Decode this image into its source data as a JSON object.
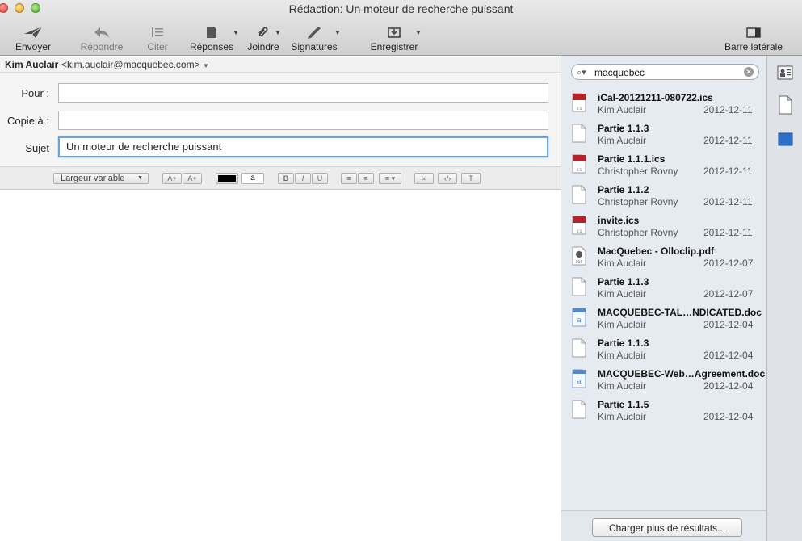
{
  "window": {
    "title": "Rédaction: Un moteur de recherche puissant"
  },
  "toolbar": {
    "send": "Envoyer",
    "reply": "Répondre",
    "quote": "Citer",
    "responses": "Réponses",
    "attach": "Joindre",
    "signatures": "Signatures",
    "save": "Enregistrer",
    "sidebar": "Barre latérale"
  },
  "from": {
    "name": "Kim Auclair",
    "address": "<kim.auclair@macquebec.com>"
  },
  "fields": {
    "to_label": "Pour :",
    "to_value": "",
    "cc_label": "Copie à :",
    "cc_value": "",
    "subject_label": "Sujet",
    "subject_value": "Un moteur de recherche puissant"
  },
  "format": {
    "font_select": "Largeur variable",
    "size_up": "A+",
    "size_down": "A+",
    "bg_swatch": "a",
    "bold": "B",
    "italic": "I",
    "underline": "U"
  },
  "search": {
    "query": "macquebec"
  },
  "results": [
    {
      "name": "iCal-20121211-080722.ics",
      "from": "Kim Auclair",
      "date": "2012-12-11",
      "icon": "ics-file-icon"
    },
    {
      "name": "Partie 1.1.3",
      "from": "Kim Auclair",
      "date": "2012-12-11",
      "icon": "doc-file-icon"
    },
    {
      "name": "Partie 1.1.1.ics",
      "from": "Christopher Rovny",
      "date": "2012-12-11",
      "icon": "ics-file-icon"
    },
    {
      "name": "Partie 1.1.2",
      "from": "Christopher Rovny",
      "date": "2012-12-11",
      "icon": "doc-file-icon"
    },
    {
      "name": "invite.ics",
      "from": "Christopher Rovny",
      "date": "2012-12-11",
      "icon": "ics-file-icon"
    },
    {
      "name": "MacQuebec - Olloclip.pdf",
      "from": "Kim Auclair",
      "date": "2012-12-07",
      "icon": "pdf-file-icon"
    },
    {
      "name": "Partie 1.1.3",
      "from": "Kim Auclair",
      "date": "2012-12-07",
      "icon": "doc-file-icon"
    },
    {
      "name": "MACQUEBEC-TAL…NDICATED.doc",
      "from": "Kim Auclair",
      "date": "2012-12-04",
      "icon": "word-file-icon"
    },
    {
      "name": "Partie 1.1.3",
      "from": "Kim Auclair",
      "date": "2012-12-04",
      "icon": "doc-file-icon"
    },
    {
      "name": "MACQUEBEC-Web…Agreement.doc",
      "from": "Kim Auclair",
      "date": "2012-12-04",
      "icon": "word-file-icon"
    },
    {
      "name": "Partie 1.1.5",
      "from": "Kim Auclair",
      "date": "2012-12-04",
      "icon": "doc-file-icon"
    }
  ],
  "load_more": "Charger plus de résultats...",
  "colors": {
    "focus": "#6ea3d8",
    "ics_red": "#b3232b",
    "panel": "#e6ebf1"
  }
}
